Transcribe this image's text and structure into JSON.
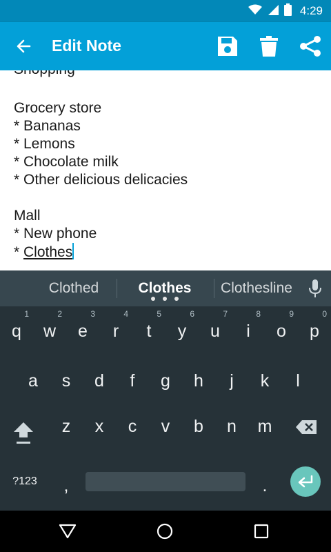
{
  "status_bar": {
    "time": "4:29",
    "icons": [
      "wifi-icon",
      "signal-icon",
      "battery-icon"
    ]
  },
  "app_bar": {
    "title": "Edit Note",
    "actions": [
      "save-icon",
      "delete-icon",
      "share-icon"
    ],
    "color": "#03a0d8"
  },
  "note": {
    "partial_line": "Shopping",
    "lines": [
      "Grocery store",
      "* Bananas",
      "* Lemons",
      "* Chocolate milk",
      "* Other delicious delicacies",
      "",
      "Mall",
      "* New phone"
    ],
    "last_line_prefix": "* ",
    "last_line_word": "Clothes"
  },
  "keyboard": {
    "suggestions": {
      "left": "Clothed",
      "center": "Clothes",
      "right": "Clothesline"
    },
    "row1": [
      {
        "key": "q",
        "hint": "1"
      },
      {
        "key": "w",
        "hint": "2"
      },
      {
        "key": "e",
        "hint": "3"
      },
      {
        "key": "r",
        "hint": "4"
      },
      {
        "key": "t",
        "hint": "5"
      },
      {
        "key": "y",
        "hint": "6"
      },
      {
        "key": "u",
        "hint": "7"
      },
      {
        "key": "i",
        "hint": "8"
      },
      {
        "key": "o",
        "hint": "9"
      },
      {
        "key": "p",
        "hint": "0"
      }
    ],
    "row2": [
      "a",
      "s",
      "d",
      "f",
      "g",
      "h",
      "j",
      "k",
      "l"
    ],
    "row3": [
      "z",
      "x",
      "c",
      "v",
      "b",
      "n",
      "m"
    ],
    "symbols_label": "?123",
    "comma_label": ",",
    "period_label": ".",
    "accent_color": "#69c6bc"
  },
  "nav_bar": {
    "buttons": [
      "back-triangle-icon",
      "home-circle-icon",
      "recents-square-icon"
    ]
  }
}
